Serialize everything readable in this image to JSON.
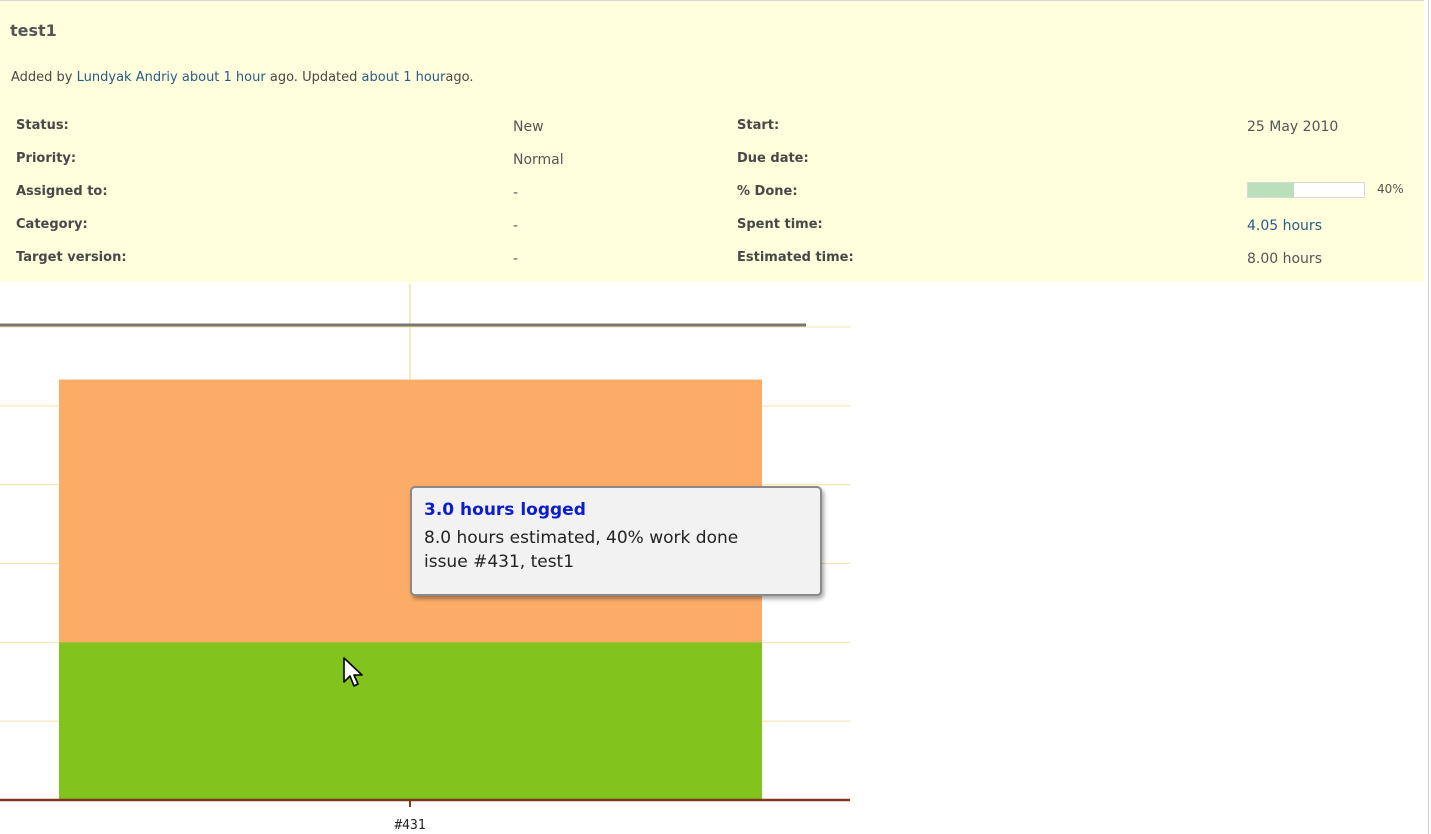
{
  "issue": {
    "title": "test1",
    "added_by_prefix": "Added by",
    "author": "Lundyak Andriy",
    "added_time": "about 1 hour",
    "mid_text": "ago. Updated",
    "updated_time": "about 1 hour",
    "suffix": "ago."
  },
  "attributes_left": [
    {
      "label": "Status:",
      "value": "New"
    },
    {
      "label": "Priority:",
      "value": "Normal"
    },
    {
      "label": "Assigned to:",
      "value": "-"
    },
    {
      "label": "Category:",
      "value": "-"
    },
    {
      "label": "Target version:",
      "value": "-"
    }
  ],
  "attributes_right": [
    {
      "label": "Start:",
      "value": "25 May 2010"
    },
    {
      "label": "Due date:",
      "value": ""
    },
    {
      "label": "% Done:",
      "value": "40%",
      "progress": 0.4
    },
    {
      "label": "Spent time:",
      "value": "4.05 hours"
    },
    {
      "label": "Estimated time:",
      "value": "8.00 hours"
    }
  ],
  "colors": {
    "estimated_bar": "#fdac68",
    "logged_bar": "#82c31e",
    "grid": "#f4e2a8",
    "axis": "#7a3a1a",
    "reference_line": "#777777",
    "progress_fill": "#bae0ba",
    "link": "#2a5a8a"
  },
  "chart_data": {
    "type": "bar",
    "categories": [
      "#431"
    ],
    "series": [
      {
        "name": "logged",
        "values": [
          3.0
        ]
      },
      {
        "name": "estimated",
        "values": [
          8.0
        ]
      }
    ],
    "ylim": [
      0,
      9
    ]
  },
  "tooltip": {
    "title": "3.0 hours logged",
    "line1": "8.0 hours estimated, 40% work done",
    "line2": "issue #431, test1"
  }
}
